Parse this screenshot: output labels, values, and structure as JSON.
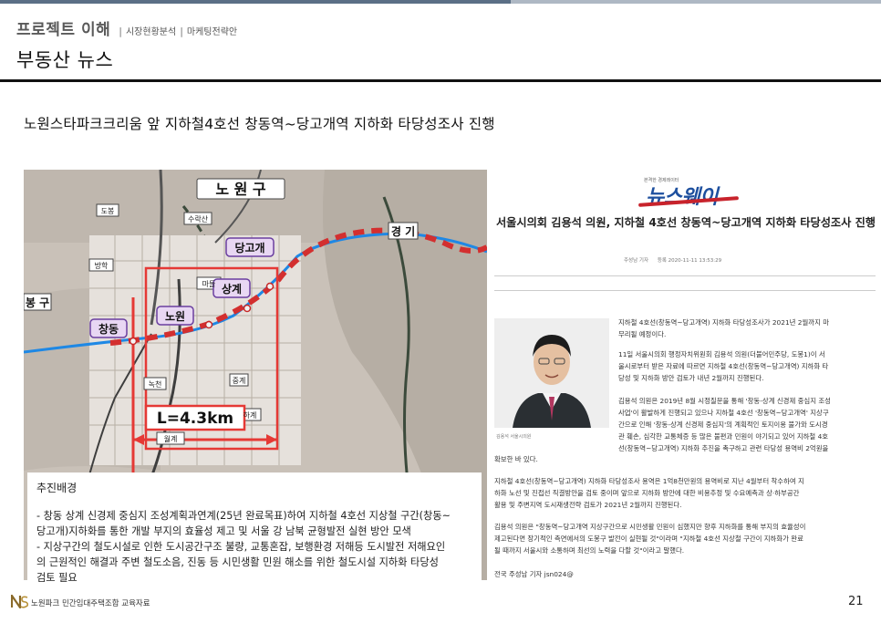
{
  "header": {
    "section_title": "프로젝트 이해",
    "crumb_sep": "|",
    "crumbs": [
      "시장현황분석",
      "마케팅전략안"
    ],
    "page_title": "부동산 뉴스"
  },
  "subtitle": "노원스타파크크리움 앞 지하철4호선 창동역~당고개역 지하화 타당성조사 진행",
  "map": {
    "district_top": "노 원 구",
    "district_mid": "경 기",
    "district_left": "봉 구",
    "stations": [
      "당고개",
      "상계",
      "노원",
      "창동"
    ],
    "place_labels": [
      "도봉",
      "수락산",
      "방학",
      "마들",
      "녹천",
      "중계",
      "하계",
      "월계"
    ],
    "distance_label": "L=4.3km",
    "colors": {
      "route": "#d32f2f",
      "line4": "#1e88e5",
      "highlight": "#e53935"
    }
  },
  "info": {
    "heading": "추진배경",
    "lines": [
      "- 창동 상계 신경제 중심지 조성계획과연계(25년 완료목표)하여 지하철 4호선 지상철 구간(창동~",
      "당고개)지하화를 통한 개발 부지의 효율성 제고 및 서울 강 남북 균형발전 실현 방안 모색",
      "- 지상구간의 철도시설로 인한 도시공간구조 불량, 교통혼잡, 보행환경 저해등 도시발전 저해요인",
      "의 근원적인 해결과 주변 철도소음, 진동 등 시민생활 민원 해소를 위한 철도시설 지하화 타당성",
      "검토 필요"
    ]
  },
  "article": {
    "logo_tagline": "본격한 경제레이터",
    "logo": "뉴스웨이",
    "headline": "서울시의회 김용석 의원, 지하철 4호선 창동역~당고개역 지하화 타당성조사 진행",
    "reporter": "주성남 기자",
    "date": "등록 2020-11-11 13:53:29",
    "photo_caption": "김용석 서울시의원",
    "paragraphs": [
      [
        "지하철 4호선(창동역~당고개역) 지하화 타당성조사가 2021년 2월까지 마",
        "무리될 예정이다."
      ],
      [
        "11일 서울시의회 행정자치위원회 김용석 의원(더불어민주당, 도봉1)이 서",
        "울시로부터 받은 자료에 따르면 지하철 4호선(창동역~당고개역) 지하화 타",
        "당성 및 지하화 방안 검토가 내년 2월까지 진행된다."
      ],
      [
        "김용석 의원은 2019년 8월 시정질문을 통해 '창동-상계 신경제 중심지 조성",
        "사업'이 활발하게 진행되고 있으나 지하철 4호선 '창동역~당고개역' 지상구",
        "간으로 인해 '창동-상계 신경제 중심지'의 계획적인 토지이용 불가와 도시경",
        "관 훼손, 심각한 교통체증 등 많은 불편과 민원이 야기되고 있어 지하철 4호",
        "선(창동역~당고개역) 지하화 추진을 촉구하고 관련 타당성 용역비 2억원을"
      ],
      [
        "확보한 바 있다."
      ],
      [
        "지하철 4호선(창동역~당고개역) 지하화 타당성조사 용역은 1억8천만원의 용역비로 지난 4월부터 착수하여 지",
        "하화 노선 및 진접선 직결방안을 검토 중이며 앞으로 지하화 방안에 대한 비용추정 및 수요예측과 상·하부공간",
        "활용 및 주변지역 도시재생전략 검토가 2021년 2월까지 진행된다."
      ],
      [
        "김용석 의원은 \"창동역~당고개역 지상구간으로 시민생활 민원이 심했지만 향후 지하화를 통해 부지의 효율성이",
        "제고된다면 장기적인 측면에서의 도봉구 발전이 실현될 것\"이라며 \"지하철 4호선 지상철 구간이 지하화가 완료",
        "될 때까지 서울시와 소통하며 최선의 노력을 다할 것\"이라고 말했다."
      ],
      [
        "전국 주성남 기자 jsn024@"
      ]
    ]
  },
  "footer": {
    "org": "노원파크 민간임대주택조합 교육자료",
    "page_number": "21"
  }
}
